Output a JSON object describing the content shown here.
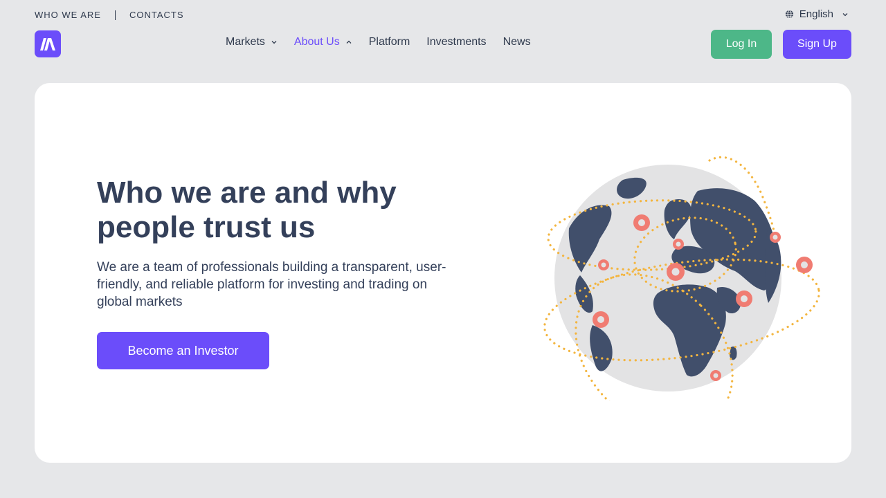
{
  "topbar": {
    "who_we_are": "WHO WE ARE",
    "contacts": "CONTACTS"
  },
  "language": {
    "label": "English",
    "icon": "globe-icon"
  },
  "logo": {
    "letter": "M",
    "color": "#6b4dfa"
  },
  "nav": {
    "items": [
      {
        "label": "Markets",
        "has_dropdown": true,
        "open": false
      },
      {
        "label": "About Us",
        "has_dropdown": true,
        "open": true
      },
      {
        "label": "Platform",
        "has_dropdown": false
      },
      {
        "label": "Investments",
        "has_dropdown": false
      },
      {
        "label": "News",
        "has_dropdown": false
      }
    ]
  },
  "auth": {
    "login_label": "Log In",
    "signup_label": "Sign Up"
  },
  "hero": {
    "title": "Who we are and why people trust us",
    "subtitle": "We are a team of professionals building a transparent, user-friendly, and reliable platform for investing and trading on global markets",
    "cta_label": "Become an Investor"
  },
  "colors": {
    "accent": "#6b4dfa",
    "login": "#4db788",
    "background": "#e6e7e9",
    "text": "#34405a",
    "globe_land": "#414f6b",
    "globe_sea": "#e3e3e4",
    "orbit": "#f3b53f",
    "pin": "#f07c72"
  }
}
